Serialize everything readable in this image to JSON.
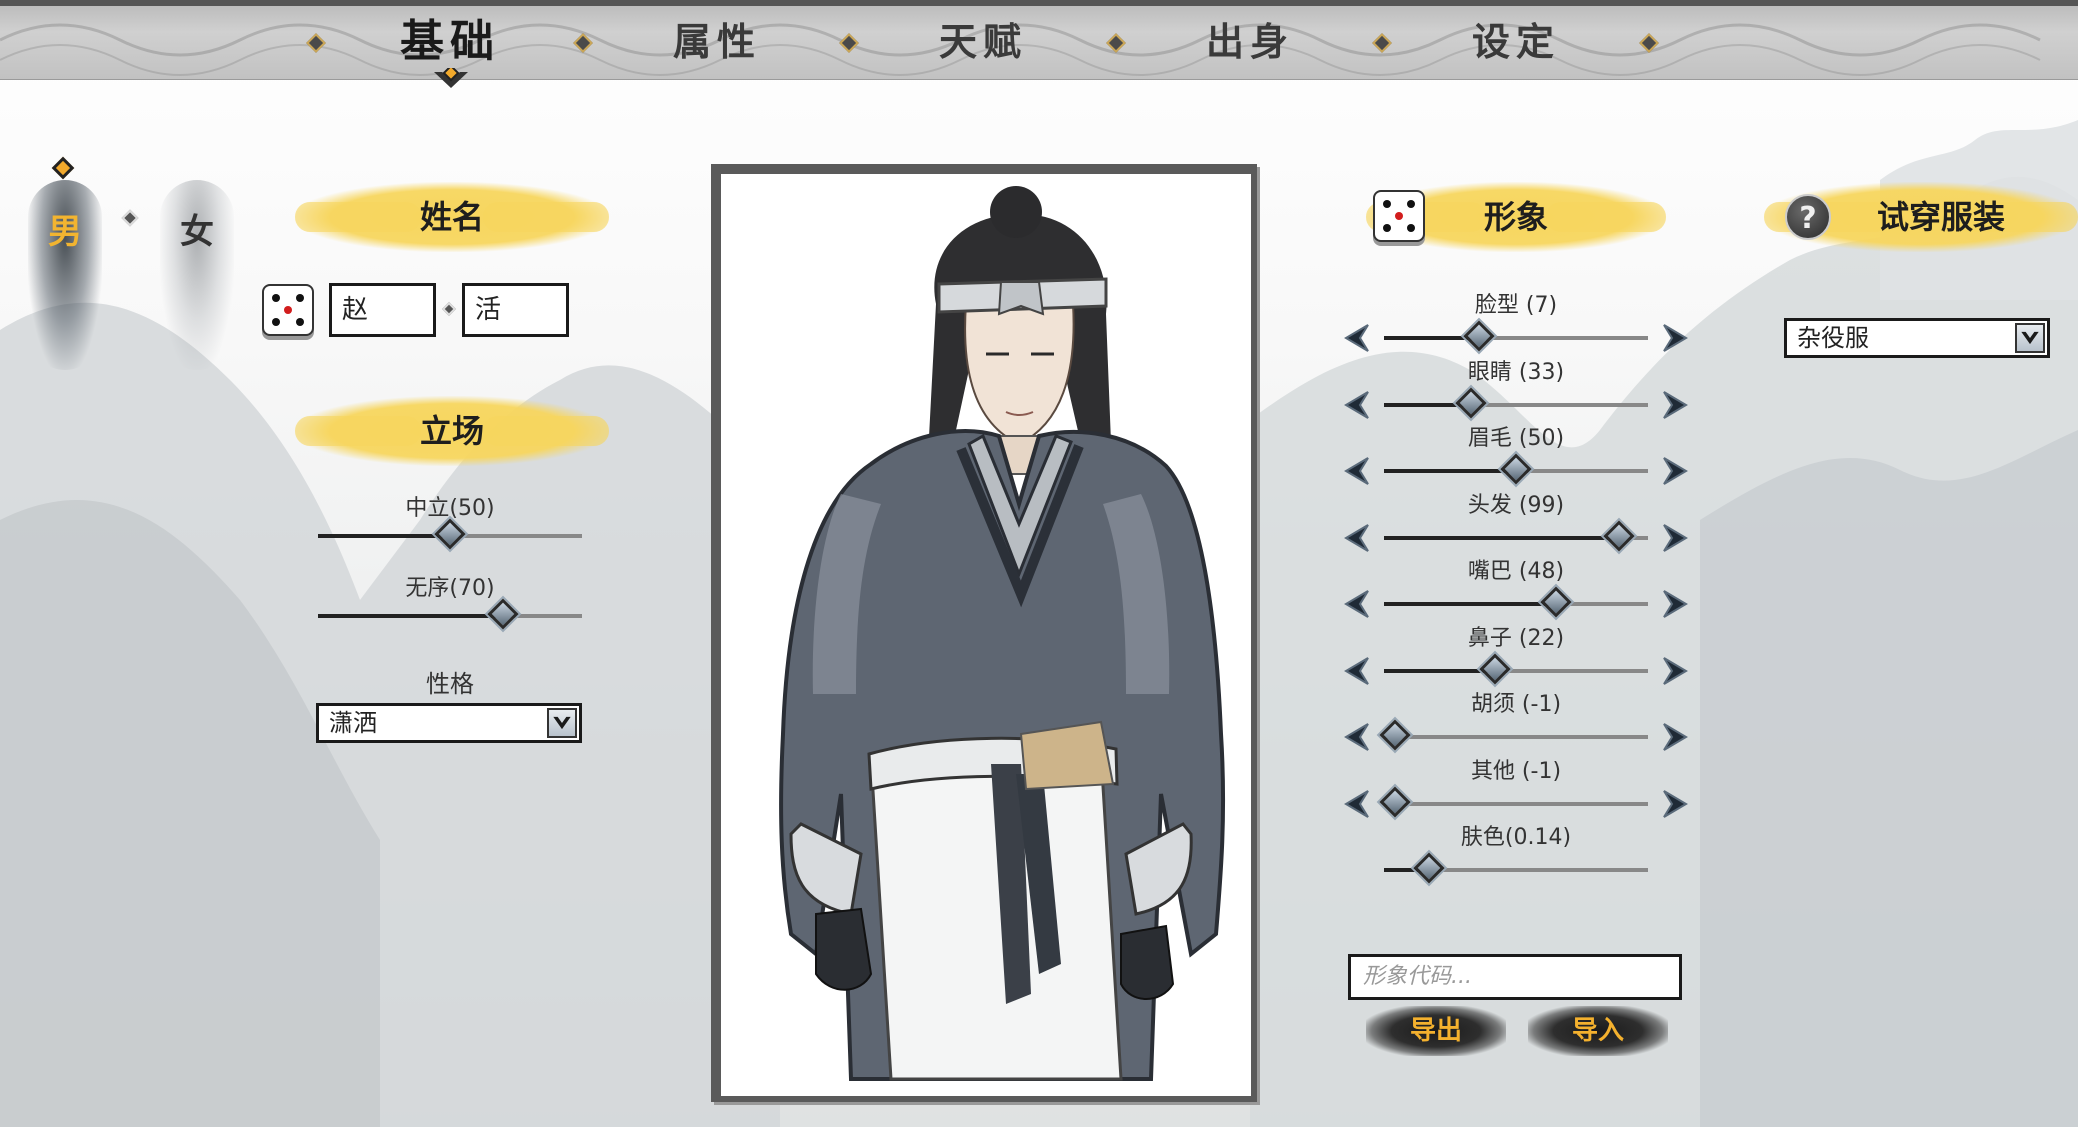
{
  "tabs": [
    {
      "label": "基础",
      "active": true
    },
    {
      "label": "属性",
      "active": false
    },
    {
      "label": "天赋",
      "active": false
    },
    {
      "label": "出身",
      "active": false
    },
    {
      "label": "设定",
      "active": false
    }
  ],
  "gender": {
    "male": "男",
    "female": "女",
    "selected": "男"
  },
  "name_section": {
    "title": "姓名",
    "surname": "赵",
    "given_name": "活"
  },
  "stance_section": {
    "title": "立场",
    "sliders": [
      {
        "label": "中立(50)",
        "value": 50,
        "max": 100
      },
      {
        "label": "无序(70)",
        "value": 70,
        "max": 100
      }
    ],
    "personality_label": "性格",
    "personality_value": "潇洒"
  },
  "appearance_section": {
    "title": "形象",
    "sliders": [
      {
        "label": "脸型  (7)",
        "value": 0.36
      },
      {
        "label": "眼睛  (33)",
        "value": 0.33
      },
      {
        "label": "眉毛  (50)",
        "value": 0.5
      },
      {
        "label": "头发  (99)",
        "value": 0.89
      },
      {
        "label": "嘴巴  (48)",
        "value": 0.65
      },
      {
        "label": "鼻子  (22)",
        "value": 0.42
      },
      {
        "label": "胡须  (-1)",
        "value": 0.04
      },
      {
        "label": "其他  (-1)",
        "value": 0.04
      },
      {
        "label": "肤色(0.14)",
        "value": 0.17
      }
    ],
    "code_placeholder": "形象代码...",
    "export_label": "导出",
    "import_label": "导入"
  },
  "outfit_section": {
    "title": "试穿服装",
    "help_glyph": "?",
    "selected": "杂役服"
  },
  "icons": {
    "dice": "dice-icon",
    "help": "question-icon",
    "dropdown": "chevron-down-icon",
    "arrow_left": "arrow-left-icon",
    "arrow_right": "arrow-right-icon"
  },
  "colors": {
    "accent_gold": "#f2b430",
    "brush_yellow": "#f7d65e",
    "ink_dark": "#1a1a1a"
  }
}
